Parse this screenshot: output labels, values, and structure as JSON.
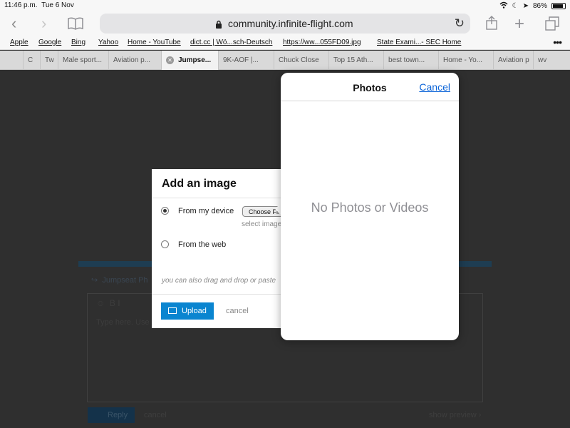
{
  "status_bar": {
    "time": "11:46 p.m.",
    "date": "Tue 6 Nov",
    "battery": "86%",
    "battery_level": 0.86
  },
  "toolbar": {
    "url": "community.infinite-flight.com"
  },
  "bookmarks": [
    "Apple",
    "Google",
    "Bing",
    "Yahoo",
    "Home - YouTube",
    "dict.cc | Wö...sch-Deutsch",
    "https://ww...055FD09.jpg",
    "State Exami...- SEC Home"
  ],
  "tabs": [
    {
      "label": "C"
    },
    {
      "label": "Tw"
    },
    {
      "label": "Male sport..."
    },
    {
      "label": "Aviation p..."
    },
    {
      "label": "Jumpse...",
      "active": true
    },
    {
      "label": "9K-AOF |..."
    },
    {
      "label": "Chuck Close"
    },
    {
      "label": "Top 15 Ath..."
    },
    {
      "label": "best town..."
    },
    {
      "label": "Home - Yo..."
    },
    {
      "label": "Aviation p"
    },
    {
      "label": "wv"
    }
  ],
  "background": {
    "composer_title": "Jumpseat Ph",
    "editor_placeholder": "Type here. Use",
    "format_buttons": "B I",
    "reply_label": "Reply",
    "cancel_label": "cancel",
    "show_preview_label": "show preview ›"
  },
  "add_image_modal": {
    "title": "Add an image",
    "option_device": "From my device",
    "choose_file": "Choose File",
    "select_hint": "select image",
    "option_web": "From the web",
    "drag_hint": "you can also drag and drop or paste",
    "upload_label": "Upload",
    "cancel_label": "cancel"
  },
  "photos_popover": {
    "title": "Photos",
    "cancel_label": "Cancel",
    "empty_message": "No Photos or Videos"
  },
  "colors": {
    "accent": "#0a85d0",
    "link": "#0a63d8",
    "dim": "#2f2f2f"
  }
}
